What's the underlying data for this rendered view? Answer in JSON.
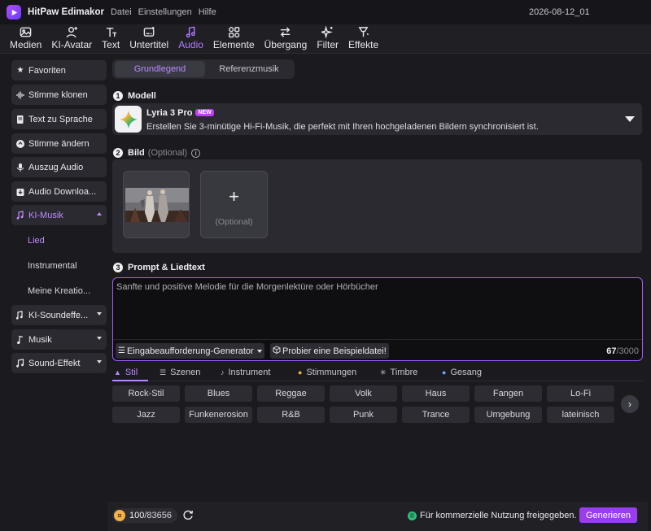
{
  "app": {
    "title": "HitPaw Edimakor",
    "menu": [
      "Datei",
      "Einstellungen",
      "Hilfe"
    ],
    "project_name": "2026-08-12_01"
  },
  "toolbar": {
    "tools": [
      {
        "label": "Medien",
        "icon": "image-icon"
      },
      {
        "label": "KI-Avatar",
        "icon": "avatar-icon"
      },
      {
        "label": "Text",
        "icon": "text-icon"
      },
      {
        "label": "Untertitel",
        "icon": "subtitle-icon"
      },
      {
        "label": "Audio",
        "icon": "music-note-icon",
        "active": true
      },
      {
        "label": "Elemente",
        "icon": "elements-icon"
      },
      {
        "label": "Übergang",
        "icon": "transition-icon"
      },
      {
        "label": "Filter",
        "icon": "sparkle-icon"
      },
      {
        "label": "Effekte",
        "icon": "magic-wand-icon"
      }
    ]
  },
  "sidebar": {
    "items": [
      {
        "label": "Favoriten",
        "icon": "star-icon"
      },
      {
        "label": "Stimme klonen",
        "icon": "waveform-icon"
      },
      {
        "label": "Text zu Sprache",
        "icon": "document-icon"
      },
      {
        "label": "Stimme ändern",
        "icon": "voice-change-icon"
      },
      {
        "label": "Auszug Audio",
        "icon": "microphone-icon"
      },
      {
        "label": "Audio Downloa...",
        "icon": "download-icon"
      },
      {
        "label": "KI-Musik",
        "icon": "ai-music-icon",
        "expanded": true
      },
      {
        "label": "KI-Soundeffe...",
        "icon": "sound-effect-icon"
      },
      {
        "label": "Musik",
        "icon": "music-note-icon"
      },
      {
        "label": "Sound-Effekt",
        "icon": "speaker-icon"
      }
    ],
    "sub_items": [
      "Lied",
      "Instrumental",
      "Meine Kreatio..."
    ],
    "selected_sub": "Lied"
  },
  "tabs": [
    "Grundlegend",
    "Referenzmusik"
  ],
  "active_tab": "Grundlegend",
  "model": {
    "section_number": "1",
    "section_title": "Modell",
    "name": "Lyria 3 Pro",
    "badge": "NEW",
    "description": "Erstellen Sie 3-minütige Hi-Fi-Musik, die perfekt mit Ihren hochgeladenen Bildern synchronisiert ist."
  },
  "image": {
    "section_number": "2",
    "section_title": "Bild",
    "optional_hint": "(Optional)",
    "add_label": "+",
    "add_hint": "(Optional)"
  },
  "prompt": {
    "section_number": "3",
    "section_title": "Prompt & Liedtext",
    "placeholder": "Sanfte und positive Melodie für die Morgenlektüre oder Hörbücher",
    "generator_button": "Eingabeaufforderung-Generator",
    "example_button": "Probier eine Beispieldatei!",
    "count_current": "67",
    "count_max": "/3000"
  },
  "categories": [
    {
      "label": "Stil",
      "icon": "style-icon",
      "active": true
    },
    {
      "label": "Szenen",
      "icon": "scenes-icon"
    },
    {
      "label": "Instrument",
      "icon": "guitar-icon"
    },
    {
      "label": "Stimmungen",
      "icon": "mood-icon"
    },
    {
      "label": "Timbre",
      "icon": "timbre-icon"
    },
    {
      "label": "Gesang",
      "icon": "vocal-icon"
    }
  ],
  "style_chips": [
    [
      "Rock-Stil",
      "Blues",
      "Reggae",
      "Volk",
      "Haus",
      "Fangen",
      "Lo-Fi"
    ],
    [
      "Jazz",
      "Funkenerosion",
      "R&B",
      "Punk",
      "Trance",
      "Umgebung",
      "lateinisch"
    ]
  ],
  "footer": {
    "credits_used": "100",
    "credits_total": "/83656",
    "commercial_text": "Für kommerzielle Nutzung freigegeben.",
    "generate_label": "Generieren"
  },
  "colors": {
    "accent": "#b27cff",
    "generate_button": "#9a3cf0",
    "prompt_border": "#a25cff",
    "check_green": "#2ec27e",
    "coin": "#f2b14a"
  }
}
